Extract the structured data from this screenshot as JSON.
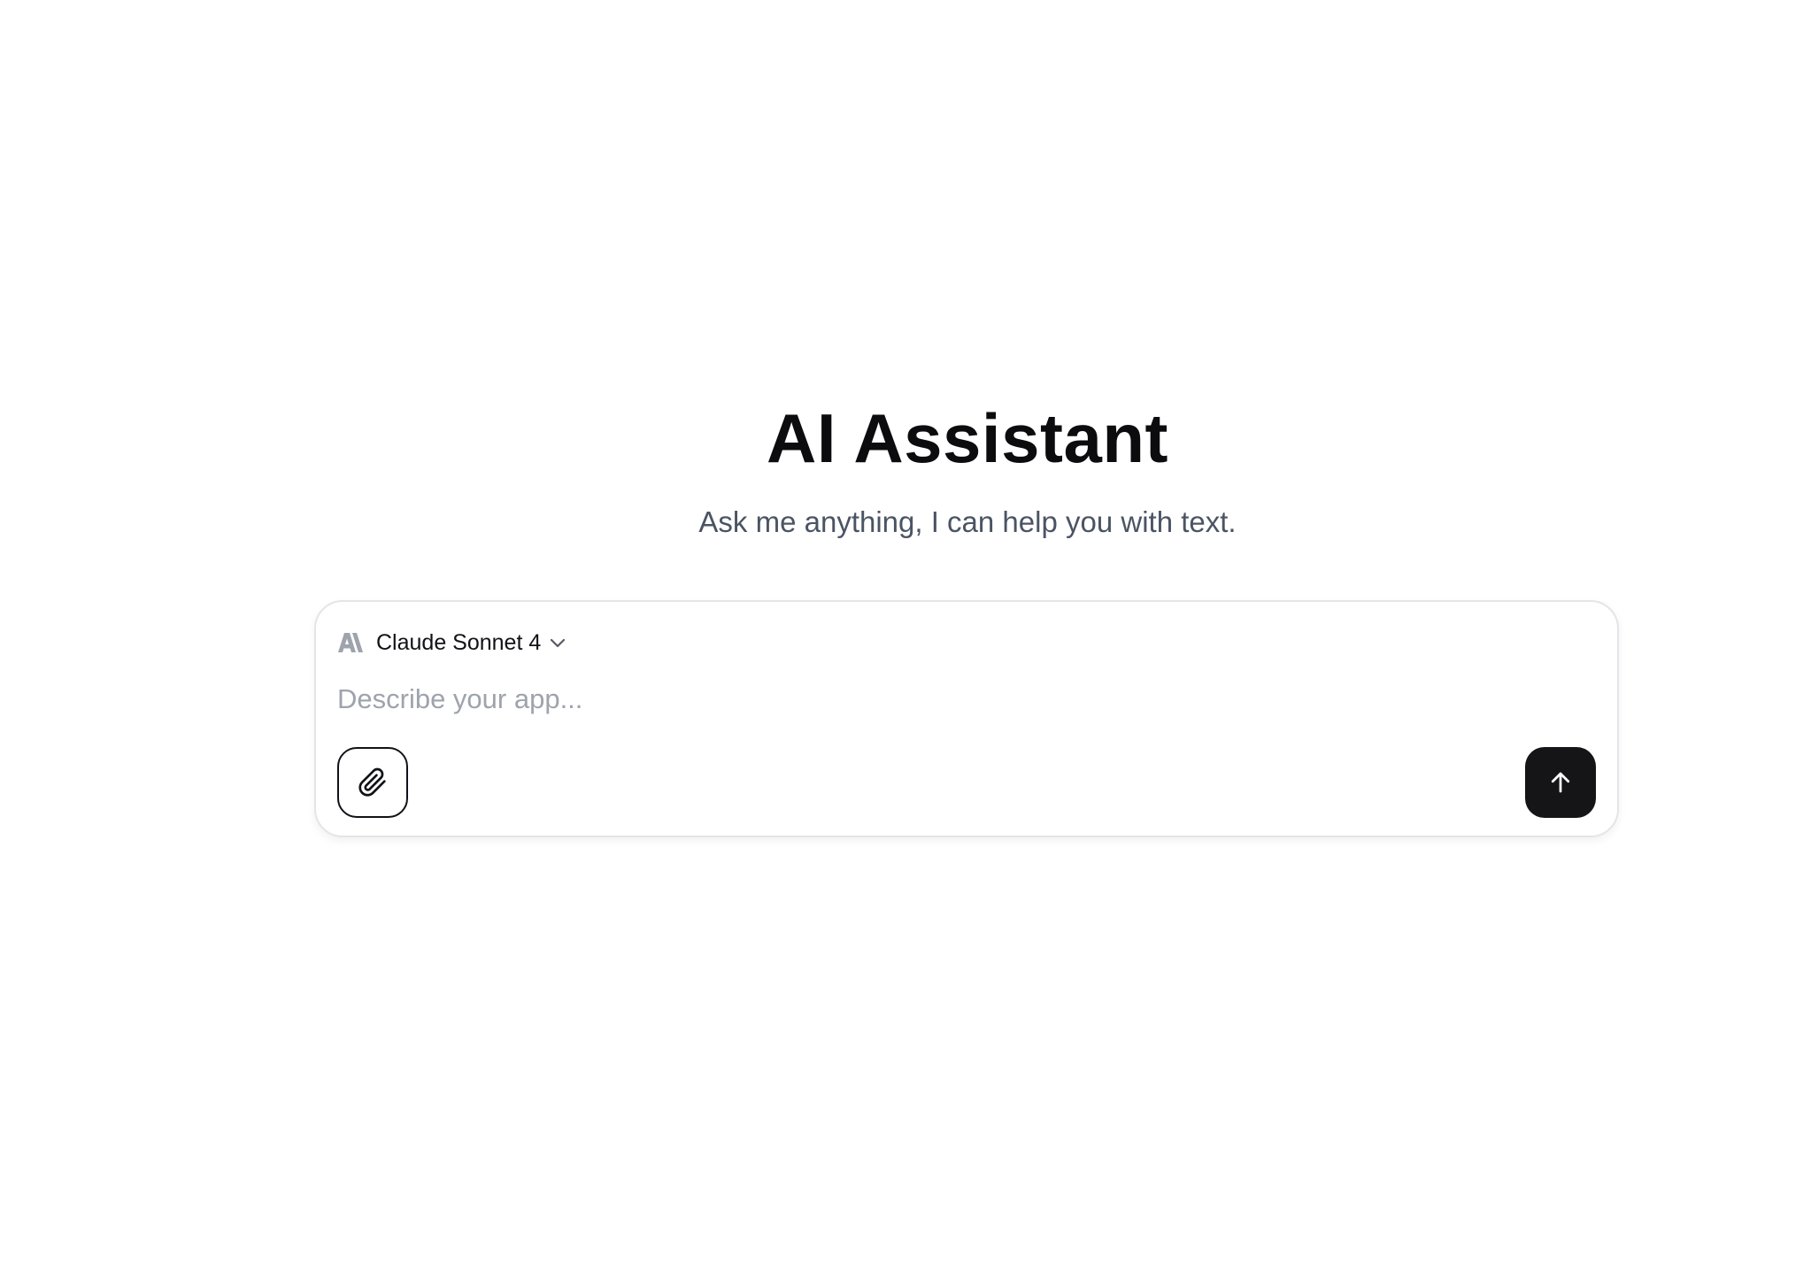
{
  "header": {
    "title": "AI Assistant",
    "subtitle": "Ask me anything, I can help you with text."
  },
  "composer": {
    "model": {
      "brand_icon": "anthropic-logo-icon",
      "name": "Claude Sonnet 4",
      "dropdown_icon": "chevron-down-icon"
    },
    "input": {
      "value": "",
      "placeholder": "Describe your app..."
    },
    "attach_icon": "paperclip-icon",
    "send_icon": "arrow-up-icon"
  },
  "colors": {
    "background": "#ffffff",
    "title": "#0c0c0e",
    "subtitle": "#4b5463",
    "placeholder": "#9ea3ac",
    "border": "#e4e5e8",
    "send_button": "#151518"
  }
}
